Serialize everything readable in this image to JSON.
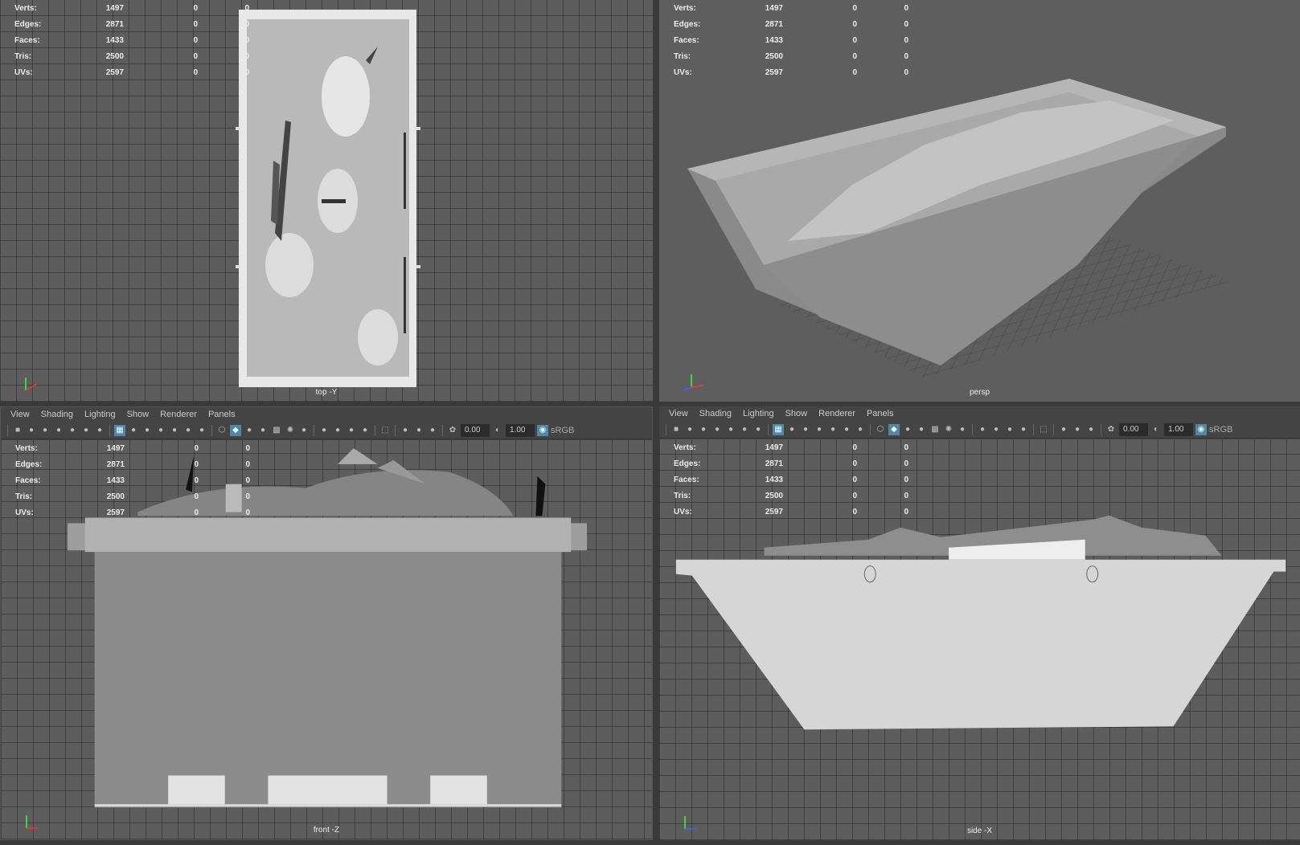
{
  "stats": {
    "rows": [
      {
        "label": "Verts:",
        "value": "1497",
        "sel": "0",
        "tri": "0"
      },
      {
        "label": "Edges:",
        "value": "2871",
        "sel": "0",
        "tri": "0"
      },
      {
        "label": "Faces:",
        "value": "1433",
        "sel": "0",
        "tri": "0"
      },
      {
        "label": "Tris:",
        "value": "2500",
        "sel": "0",
        "tri": "0"
      },
      {
        "label": "UVs:",
        "value": "2597",
        "sel": "0",
        "tri": "0"
      }
    ]
  },
  "viewports": {
    "top": "top -Y",
    "persp": "persp",
    "front": "front -Z",
    "side": "side -X"
  },
  "menu": [
    "View",
    "Shading",
    "Lighting",
    "Show",
    "Renderer",
    "Panels"
  ],
  "toolbar": {
    "icons1": [
      "camera-icon",
      "camera-lock-icon",
      "camera-attr-icon",
      "bookmark-icon",
      "image-plane-icon",
      "2d-pan-icon",
      "grease-pencil-icon"
    ],
    "icons2": [
      "grid-icon",
      "film-gate-icon",
      "resolution-gate-icon",
      "gate-mask-icon",
      "field-chart-icon",
      "safe-action-icon",
      "safe-title-icon"
    ],
    "icons3": [
      "wireframe-icon",
      "smooth-shade-icon",
      "default-material-icon",
      "wireframe-on-shaded-icon",
      "xray-icon",
      "use-all-lights-icon",
      "shadows-icon"
    ],
    "icons4": [
      "screen-space-ao-icon",
      "motion-blur-icon",
      "multisample-aa-icon",
      "depth-of-field-icon"
    ],
    "icons5": [
      "isolate-select-icon"
    ],
    "icons6": [
      "xray-joints-icon",
      "xray-active-icon",
      "backface-culling-icon"
    ],
    "exposure": "0.00",
    "gamma": "1.00",
    "colorspace": "sRGB"
  },
  "colors": {
    "accent": "#5285a6",
    "viewport_bg": "#5d5d5d",
    "panel_bg": "#444444"
  }
}
